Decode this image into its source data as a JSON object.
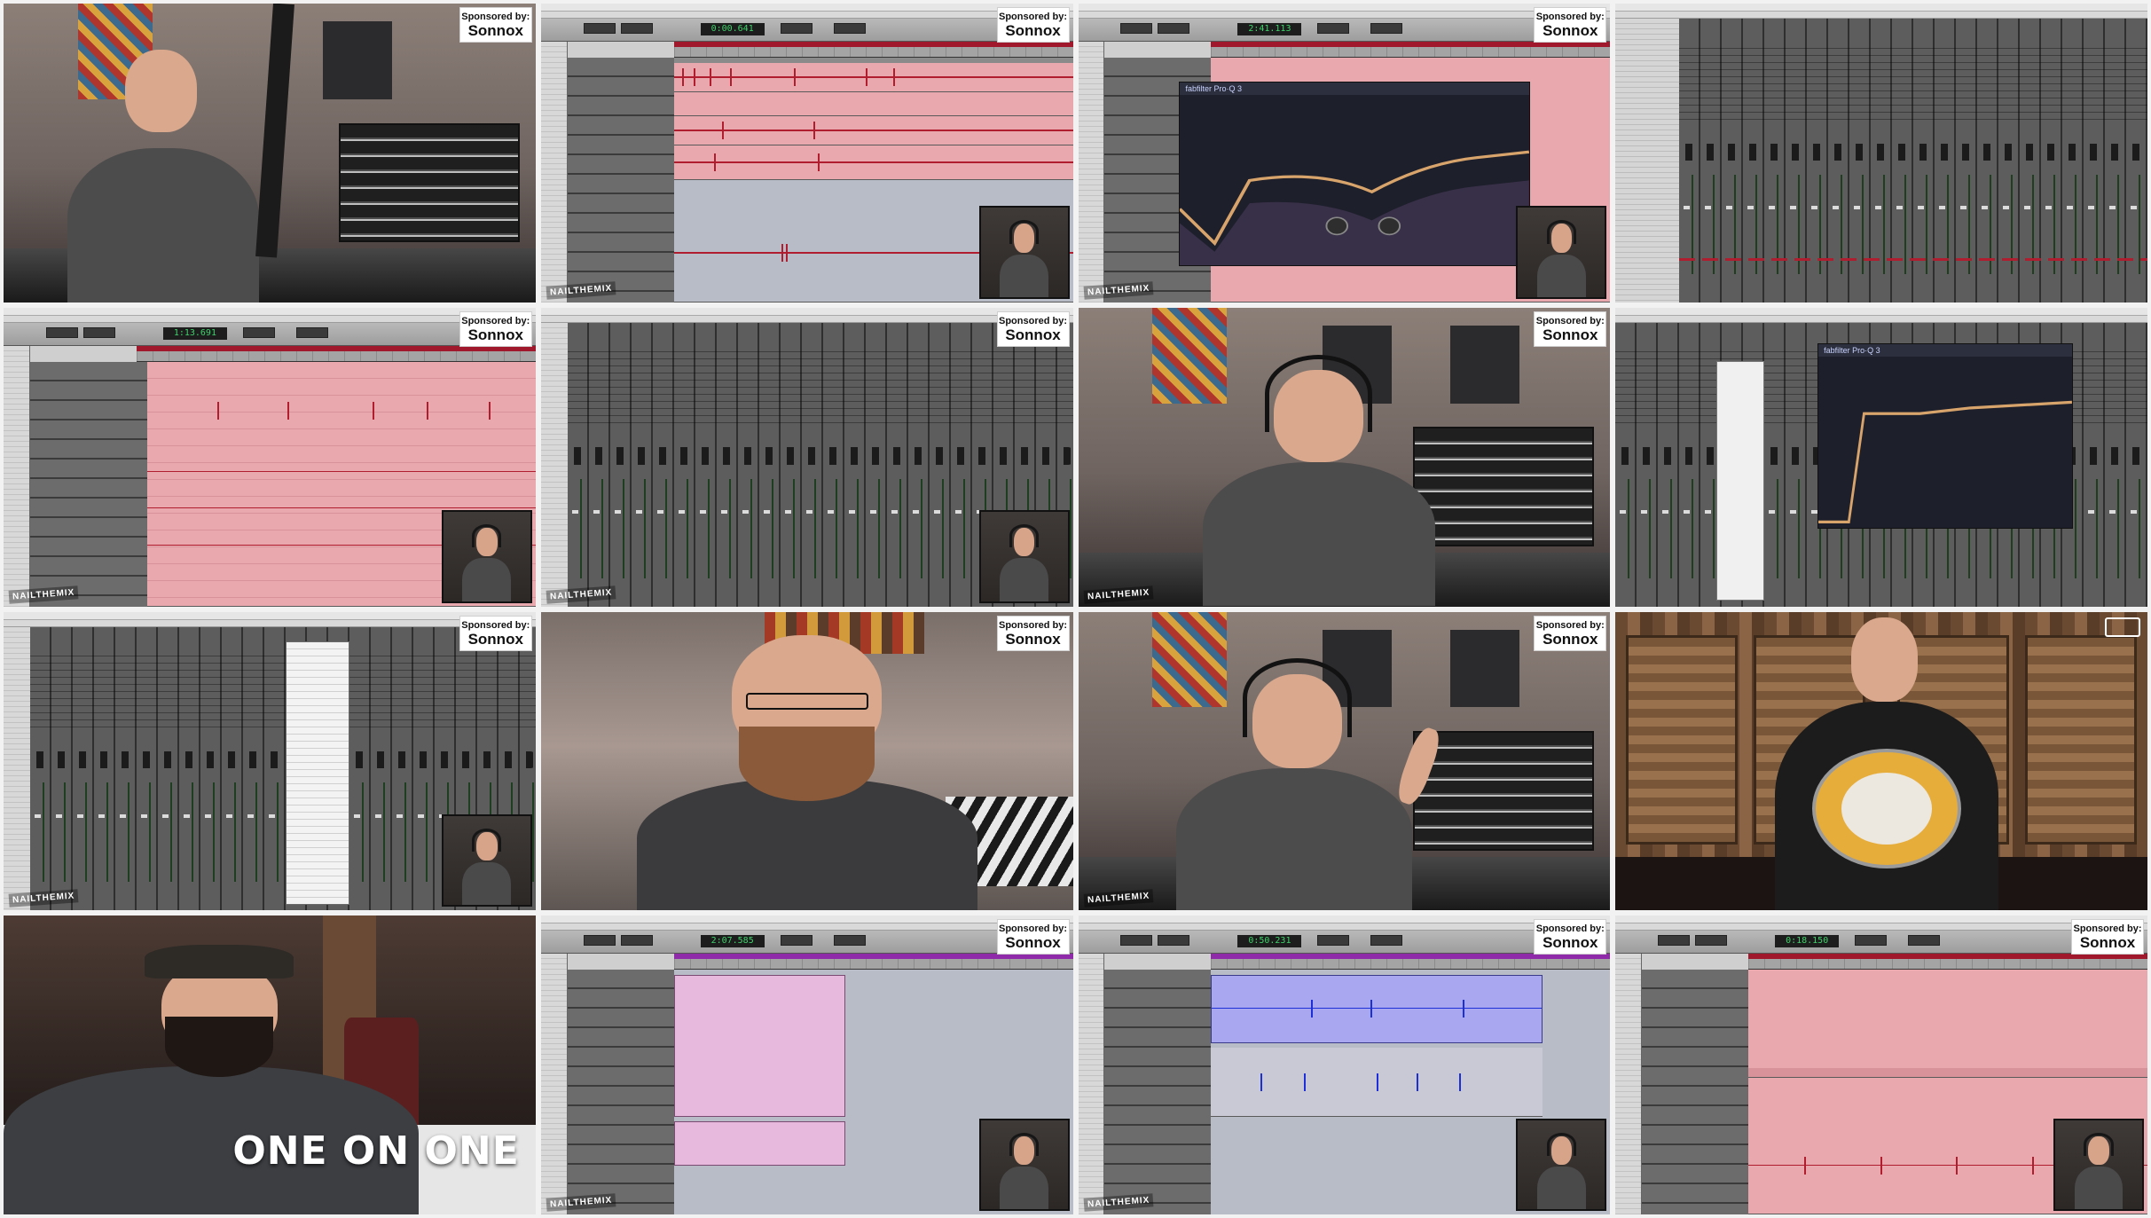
{
  "sponsor": {
    "line1": "Sponsored by:",
    "line2": "Sonnox"
  },
  "logo_text": "NAILTHEMIX",
  "one_on_one": "ONE ON ONE",
  "counters": {
    "r1c2": "0:00.641",
    "r1c3": "2:41.113",
    "r2c1": "1:13.691",
    "r4c2": "2:07.585",
    "r4c3": "0:50.231",
    "r4c4": "0:18.150"
  },
  "plugin_name": "fabfilter Pro·Q 3",
  "colors": {
    "red_clip": "#e8a8ae",
    "red_wave": "#b01d2e",
    "pink_clip": "#e6b9dd",
    "blue_clip": "#a9a7ef",
    "blue_wave": "#1d2fd6",
    "purple_ruler": "#8f2aa8"
  }
}
